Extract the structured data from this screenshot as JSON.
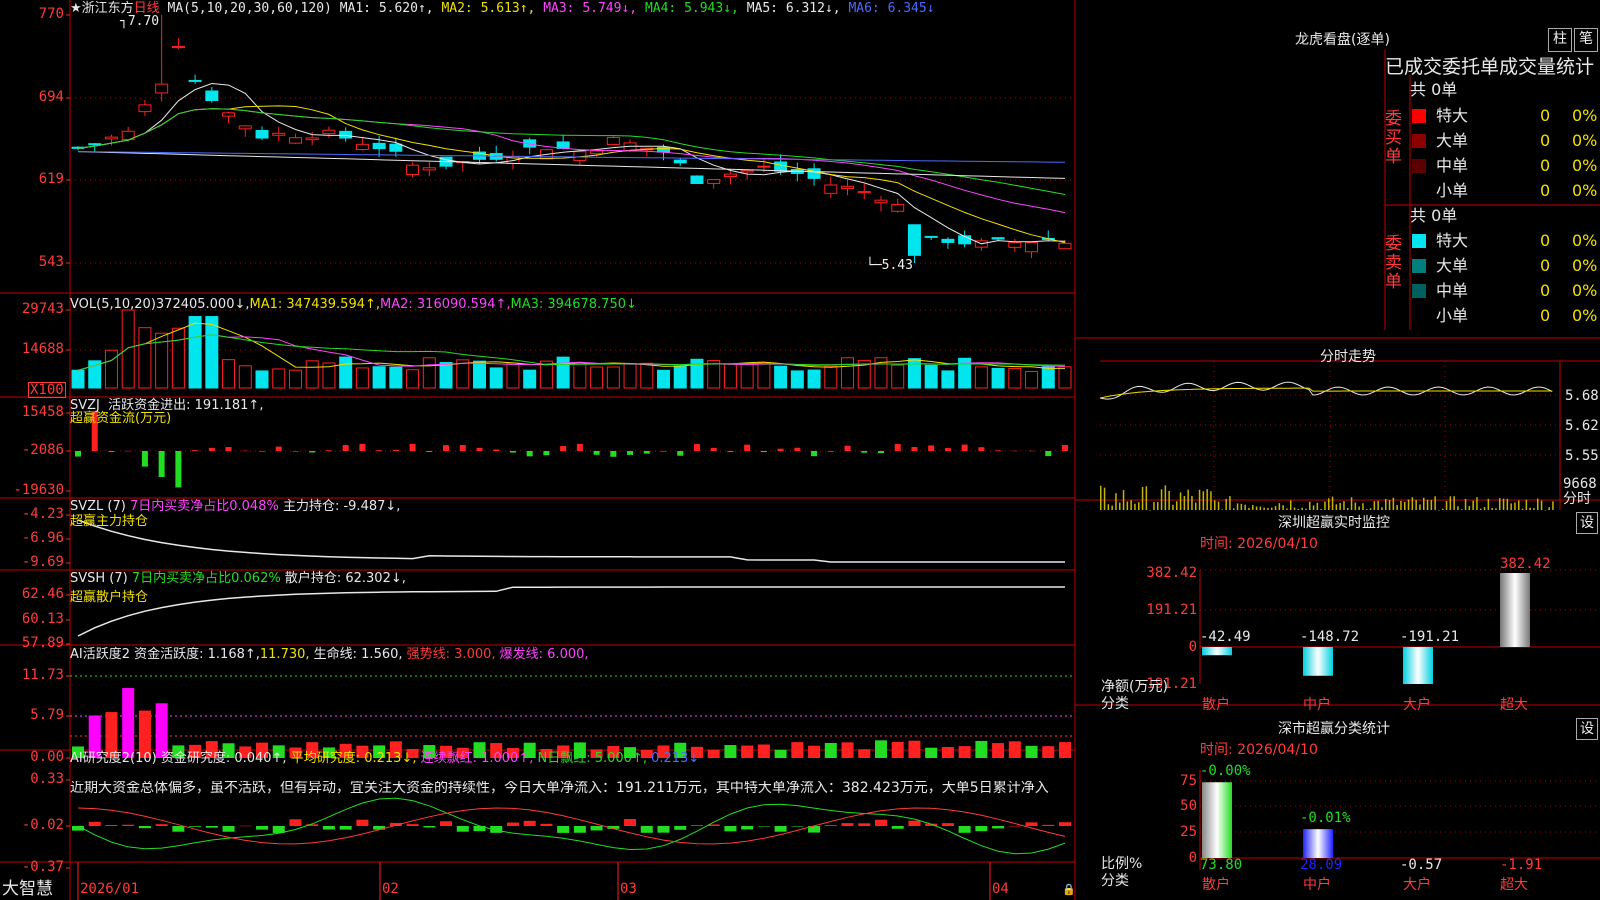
{
  "stock": {
    "name": "★浙江东方",
    "period": "日线"
  },
  "main": {
    "ma_header": [
      {
        "t": "MA(5,10,20,30,60,120)",
        "c": "w"
      },
      {
        "t": "MA1: 5.620↑,",
        "c": "w"
      },
      {
        "t": "MA2: 5.613↑,",
        "c": "y"
      },
      {
        "t": "MA3: 5.749↓,",
        "c": "m"
      },
      {
        "t": "MA4: 5.943↓,",
        "c": "g"
      },
      {
        "t": "MA5: 6.312↓,",
        "c": "w"
      },
      {
        "t": "MA6: 6.345↓",
        "c": "b"
      }
    ],
    "price_ticks": [
      "770",
      "694",
      "619",
      "543"
    ],
    "high_label": "7.70",
    "low_label": "5.43"
  },
  "vol": {
    "header": [
      {
        "t": "VOL(5,10,20)",
        "c": "w"
      },
      {
        "t": "372405.000↓,",
        "c": "w"
      },
      {
        "t": "MA1: 347439.594↑,",
        "c": "y"
      },
      {
        "t": "MA2: 316090.594↑,",
        "c": "m"
      },
      {
        "t": "MA3: 394678.750↓",
        "c": "g"
      }
    ],
    "ticks": [
      "29743",
      "14688"
    ],
    "unit": "X100"
  },
  "svzj": {
    "header": [
      {
        "t": "SVZJ  活跃资金进出: 191.181↑,",
        "c": "w"
      }
    ],
    "sub": "超赢资金流(万元)",
    "ticks": [
      "15458",
      "-2086",
      "-19630"
    ]
  },
  "svzl": {
    "header": [
      {
        "t": "SVZL (7) ",
        "c": "w"
      },
      {
        "t": "7日内买卖净占比0.048%",
        "c": "m"
      },
      {
        "t": " 主力持仓: -9.487↓,",
        "c": "w"
      }
    ],
    "sub": "超赢主力持仓",
    "ticks": [
      "-4.23",
      "-6.96",
      "-9.69"
    ]
  },
  "svsh": {
    "header": [
      {
        "t": "SVSH (7) ",
        "c": "w"
      },
      {
        "t": "7日内买卖净占比0.062%",
        "c": "g"
      },
      {
        "t": " 散户持仓: 62.302↓,",
        "c": "w"
      }
    ],
    "sub": "超赢散户持仓",
    "ticks": [
      "62.46",
      "60.13",
      "57.89"
    ]
  },
  "ai1": {
    "header": [
      {
        "t": "AI活跃度2 资金活跃度: 1.168↑,",
        "c": "w"
      },
      {
        "t": "11.730,",
        "c": "y"
      },
      {
        "t": " 生命线: 1.560,",
        "c": "w"
      },
      {
        "t": " 强势线: 3.000,",
        "c": "r"
      },
      {
        "t": " 爆发线: 6.000,",
        "c": "m"
      }
    ],
    "ticks": [
      "11.73",
      "5.79",
      "0.00"
    ]
  },
  "ai2": {
    "header": [
      {
        "t": "AI研究度2(10) 资金研究度: 0.040↑,",
        "c": "w"
      },
      {
        "t": " 平均研究度: 0.213↓,",
        "c": "y"
      },
      {
        "t": " 连续飘红: 1.000↑,",
        "c": "m"
      },
      {
        "t": " N日飘红: 5.000↑,",
        "c": "g"
      },
      {
        "t": " 0.213↓",
        "c": "b"
      }
    ],
    "comment": "近期大资金总体偏多，虽不活跃，但有异动，宜关注大资金的持续性，今日大单净流入：191.211万元，其中特大单净流入：382.423万元，大单5日累计净入",
    "ticks": [
      "0.33",
      "-0.02",
      "-0.37"
    ]
  },
  "xaxis": {
    "labels": [
      "2026/01",
      "02",
      "03",
      "04"
    ]
  },
  "brand": "大智慧",
  "right": {
    "longhu": {
      "title": "龙虎看盘(逐单)",
      "btn_zhu": "柱",
      "btn_bi": "笔",
      "stats_title": "已成交委托单成交量统计",
      "buy_label": "委买单",
      "sell_label": "委卖单",
      "buy_total": "共 0单",
      "sell_total": "共 0单",
      "buy_rows": [
        {
          "name": "特大",
          "vol": "0",
          "pct": "0%",
          "color": "#ff0000"
        },
        {
          "name": "大单",
          "vol": "0",
          "pct": "0%",
          "color": "#8b0000"
        },
        {
          "name": "中单",
          "vol": "0",
          "pct": "0%",
          "color": "#5a0000"
        },
        {
          "name": "小单",
          "vol": "0",
          "pct": "0%",
          "color": ""
        }
      ],
      "sell_rows": [
        {
          "name": "特大",
          "vol": "0",
          "pct": "0%",
          "color": "#00e5ee"
        },
        {
          "name": "大单",
          "vol": "0",
          "pct": "0%",
          "color": "#007f7f"
        },
        {
          "name": "中单",
          "vol": "0",
          "pct": "0%",
          "color": "#005f5f"
        },
        {
          "name": "小单",
          "vol": "0",
          "pct": "0%",
          "color": ""
        }
      ]
    },
    "intraday": {
      "title": "分时走势",
      "ticks": [
        "5.68",
        "5.62",
        "5.55"
      ],
      "vol_tick": "9668",
      "vol_label": "分时"
    },
    "sz_monitor": {
      "title": "深圳超赢实时监控",
      "btn": "设",
      "time": "时间: 2026/04/10",
      "ticks": [
        "382.42",
        "191.21",
        "0",
        "-191.21"
      ],
      "y_label": "净额(万元)",
      "x_label": "分类",
      "categories": [
        "散户",
        "中户",
        "大户",
        "超大"
      ],
      "values": [
        -42.49,
        -148.72,
        -191.21,
        382.42
      ],
      "value_labels": [
        "-42.49",
        "-148.72",
        "-191.21",
        "382.42"
      ]
    },
    "sz_class": {
      "title": "深市超赢分类统计",
      "btn": "设",
      "time": "时间: 2026/04/10",
      "ticks": [
        "75",
        "50",
        "25",
        "0"
      ],
      "y_label": "比例%",
      "x_label": "分类",
      "categories": [
        "散户",
        "中户",
        "大户",
        "超大"
      ],
      "values": [
        73.8,
        28.09,
        -0.57,
        -1.91
      ],
      "value_labels": [
        "73.80",
        "28.09",
        "-0.57",
        "-1.91"
      ],
      "top_labels": [
        "-0.00%",
        "-0.01%"
      ]
    }
  },
  "chart_data": {
    "type": "candlestick",
    "title": "浙江东方 日线",
    "x_labels": [
      "2026/01",
      "02",
      "03",
      "04"
    ],
    "ylim": [
      5.2,
      7.8
    ],
    "high": 7.7,
    "low": 5.43,
    "series_count": 60,
    "note_ma": {
      "MA1": 5.62,
      "MA2": 5.613,
      "MA3": 5.749,
      "MA4": 5.943,
      "MA5": 6.312,
      "MA6": 6.345
    }
  }
}
